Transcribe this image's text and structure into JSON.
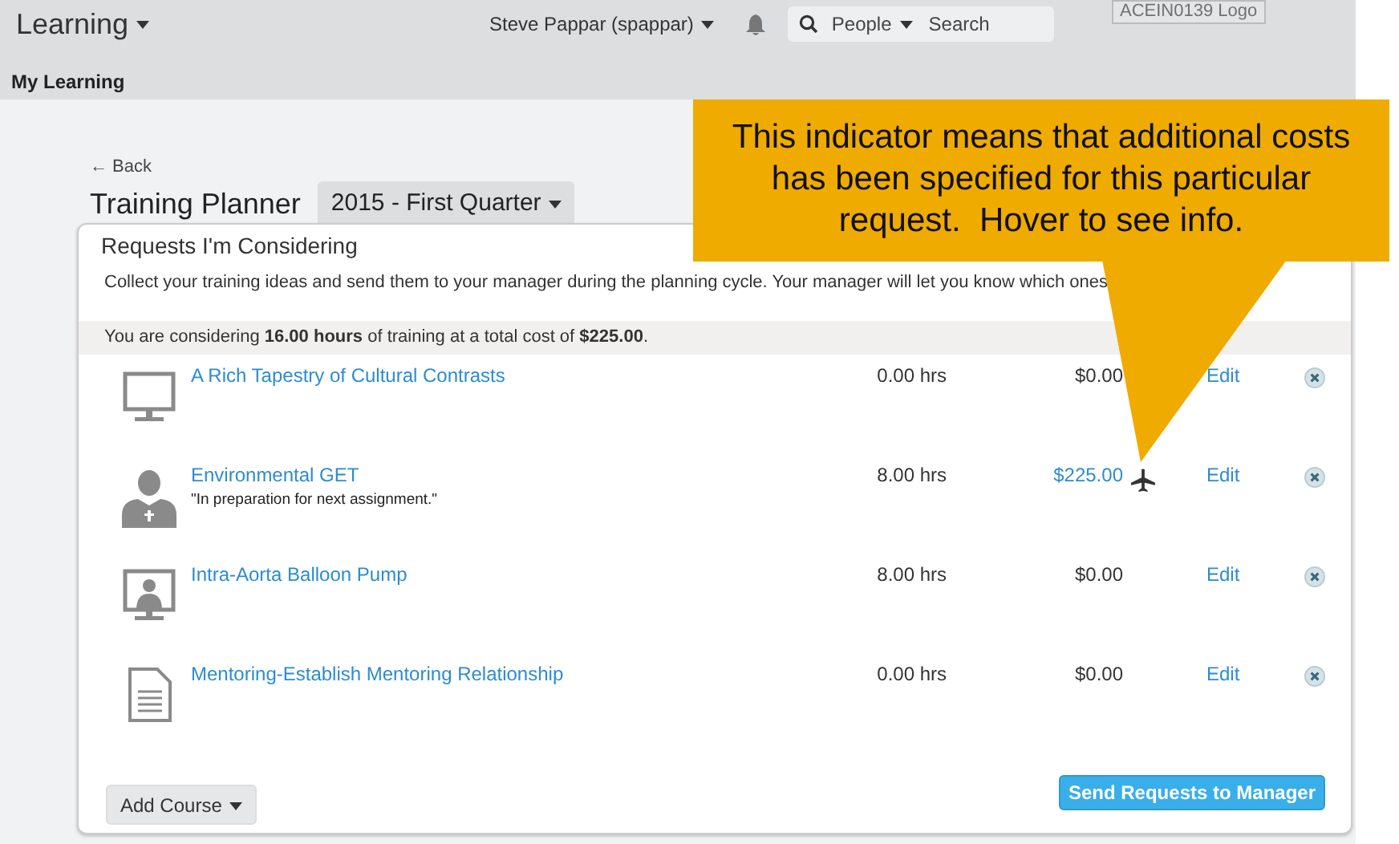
{
  "header": {
    "app_menu": "Learning",
    "user_menu": "Steve Pappar (spappar)",
    "search_scope": "People",
    "search_placeholder": "Search",
    "logo_alt": "ACEIN0139 Logo",
    "section": "My Learning"
  },
  "back_link": "← Back",
  "page_title": "Training Planner",
  "period_dropdown": "2015 - First Quarter",
  "card": {
    "title": "Requests I'm Considering",
    "description": "Collect your training ideas and send them to your manager during the planning cycle. Your manager will let you know which ones",
    "summary": "You are considering **16.00 hours** of training at a total cost of **$225.00**.",
    "requests": [
      {
        "kind": "monitor",
        "title": "A Rich Tapestry of Cultural Contrasts",
        "hours": "0.00 hrs",
        "cost": "$0.00",
        "additional_costs": false,
        "action": "Edit"
      },
      {
        "kind": "person",
        "title": "Environmental GET",
        "note": "\"In preparation for next assignment.\"",
        "hours": "8.00 hrs",
        "cost": "$225.00",
        "additional_costs": true,
        "action": "Edit"
      },
      {
        "kind": "presenter",
        "title": "Intra-Aorta Balloon Pump",
        "hours": "8.00 hrs",
        "cost": "$0.00",
        "additional_costs": false,
        "action": "Edit"
      },
      {
        "kind": "document",
        "title": "Mentoring-Establish Mentoring Relationship",
        "hours": "0.00 hrs",
        "cost": "$0.00",
        "additional_costs": false,
        "action": "Edit"
      }
    ],
    "add_button": "Add Course",
    "send_button": "Send Requests to Manager"
  },
  "callout": "This indicator means that additional costs has been specified for this particular request.  Hover to see info."
}
